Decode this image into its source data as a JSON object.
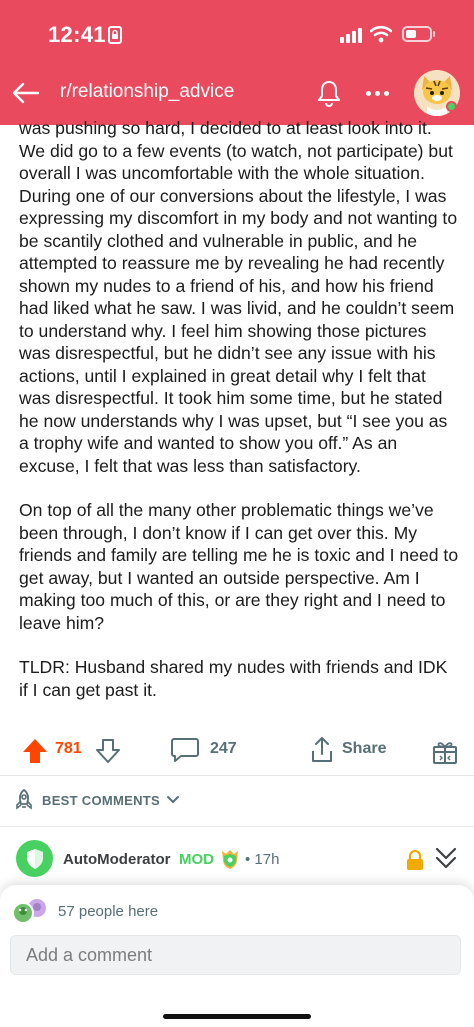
{
  "status_bar": {
    "time": "12:41"
  },
  "header": {
    "subreddit": "r/relationship_advice",
    "accent_color": "#ea4a5d"
  },
  "post": {
    "paragraphs": [
      "was pushing so hard, I decided to at least look into it. We did go to a few events (to watch, not participate) but overall I was uncomfortable with the whole situation. During one of our conversions about the lifestyle, I was expressing my discomfort in my body and not wanting to be scantily clothed and vulnerable in public, and he attempted to reassure me by revealing he had recently shown my nudes to a friend of his, and how his friend had liked what he saw. I was livid, and he couldn’t seem to understand why. I feel him showing those pictures was disrespectful, but he didn’t see any issue with his actions, until I explained in great detail why I felt that was disrespectful.  It took him some time, but he stated he now understands why I was upset, but “I see you as a trophy wife and wanted to show you off.” As an excuse, I felt that was less than satisfactory.",
      "On top of all the many other problematic things we’ve been through, I don’t know if I can get over this. My friends and family are telling me he is toxic and I need to get away, but I wanted an outside perspective. Am I making too much of this, or are they right and I need to leave him?",
      "TLDR: Husband shared my nudes with friends and IDK if I can get past it."
    ]
  },
  "actions": {
    "score": "781",
    "comments": "247",
    "share_label": "Share"
  },
  "sort": {
    "label": "BEST COMMENTS"
  },
  "automod_comment": {
    "author": "AutoModerator",
    "badge": "MOD",
    "time": "• 17h"
  },
  "composer": {
    "presence_text": "57 people here",
    "placeholder": "Add a comment"
  },
  "icons": {
    "back": "back-arrow-icon",
    "notifications": "bell-icon",
    "more": "more-dots-icon",
    "upvote": "upvote-arrow-icon",
    "downvote": "downvote-arrow-icon",
    "comment": "comment-bubble-icon",
    "share": "share-icon",
    "award": "award-gift-icon",
    "sort": "rocket-icon",
    "locked": "lock-icon",
    "collapse": "collapse-chevron-icon"
  }
}
